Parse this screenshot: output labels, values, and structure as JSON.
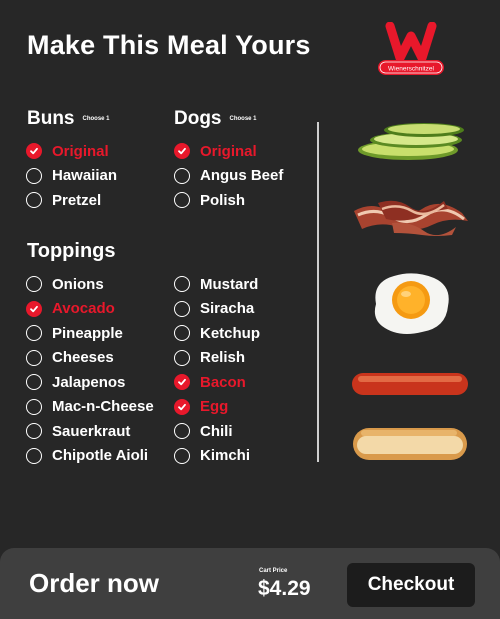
{
  "title": "Make This Meal Yours",
  "logo": {
    "text": "Wienerschnitzel",
    "color": "#e8182b"
  },
  "accent_color": "#e8182b",
  "buns": {
    "heading": "Buns",
    "hint": "Choose 1",
    "options": [
      {
        "label": "Original",
        "selected": true
      },
      {
        "label": "Hawaiian",
        "selected": false
      },
      {
        "label": "Pretzel",
        "selected": false
      }
    ]
  },
  "dogs": {
    "heading": "Dogs",
    "hint": "Choose 1",
    "options": [
      {
        "label": "Original",
        "selected": true
      },
      {
        "label": "Angus Beef",
        "selected": false
      },
      {
        "label": "Polish",
        "selected": false
      }
    ]
  },
  "toppings": {
    "heading": "Toppings",
    "left": [
      {
        "label": "Onions",
        "selected": false
      },
      {
        "label": "Avocado",
        "selected": true
      },
      {
        "label": "Pineapple",
        "selected": false
      },
      {
        "label": "Cheeses",
        "selected": false
      },
      {
        "label": "Jalapenos",
        "selected": false
      },
      {
        "label": "Mac-n-Cheese",
        "selected": false
      },
      {
        "label": "Sauerkraut",
        "selected": false
      },
      {
        "label": "Chipotle Aioli",
        "selected": false
      }
    ],
    "right": [
      {
        "label": "Mustard",
        "selected": false
      },
      {
        "label": "Siracha",
        "selected": false
      },
      {
        "label": "Ketchup",
        "selected": false
      },
      {
        "label": "Relish",
        "selected": false
      },
      {
        "label": "Bacon",
        "selected": true
      },
      {
        "label": "Egg",
        "selected": true
      },
      {
        "label": "Chili",
        "selected": false
      },
      {
        "label": "Kimchi",
        "selected": false
      }
    ]
  },
  "preview_icons": [
    "avocado-slices-icon",
    "bacon-strips-icon",
    "fried-egg-icon",
    "hot-dog-sausage-icon",
    "hot-dog-bun-icon"
  ],
  "footer": {
    "order_label": "Order now",
    "cart_label": "Cart Price",
    "cart_price": "$4.29",
    "checkout_label": "Checkout"
  }
}
